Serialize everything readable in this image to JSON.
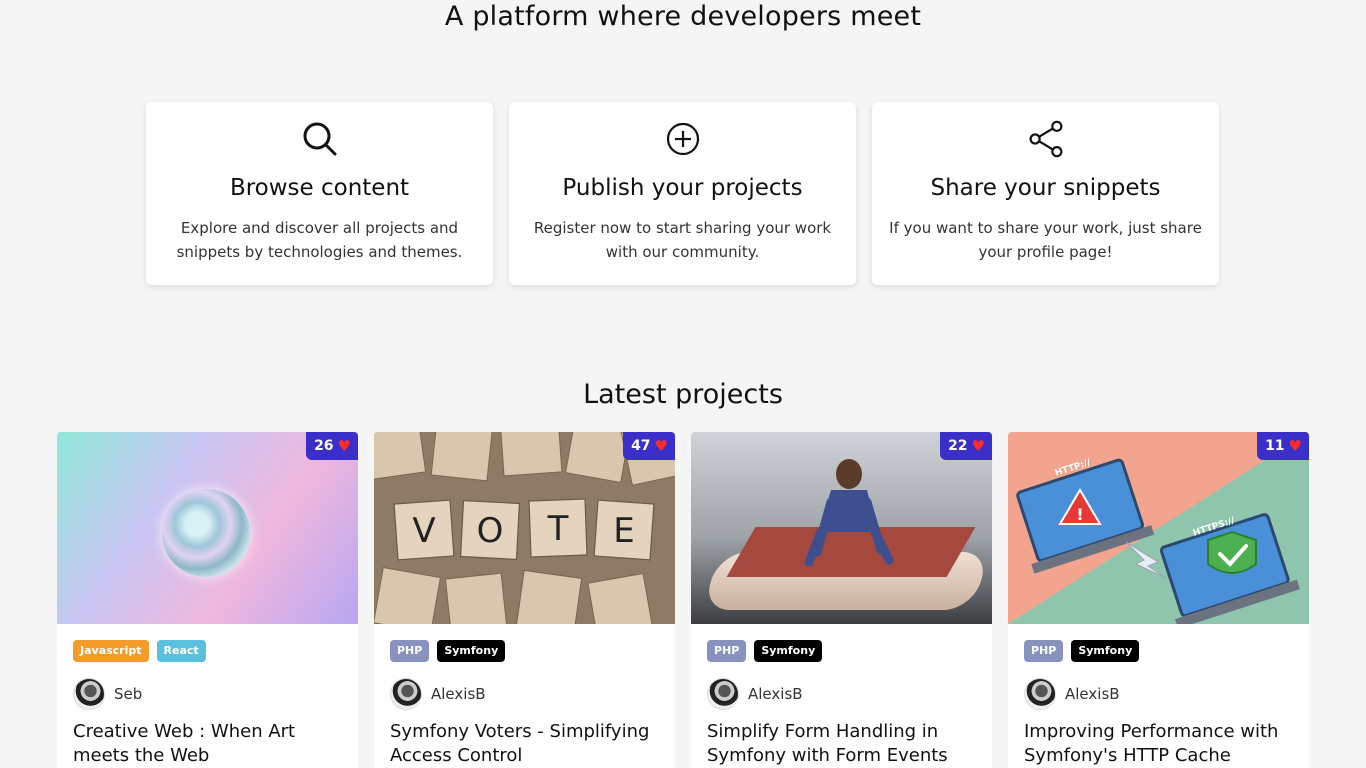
{
  "headline": "A platform where developers meet",
  "features": [
    {
      "icon": "search-icon",
      "title": "Browse content",
      "desc": "Explore and discover all projects and snippets by technologies and themes."
    },
    {
      "icon": "plus-circle-icon",
      "title": "Publish your projects",
      "desc": "Register now to start sharing your work with our community."
    },
    {
      "icon": "share-icon",
      "title": "Share your snippets",
      "desc": "If you want to share your work, just share your profile page!"
    }
  ],
  "latest_title": "Latest projects",
  "colors": {
    "likes_badge": "#3b2fc9",
    "heart": "#ff2b2b",
    "javascript": "#f39c2a",
    "react": "#5bc0de",
    "php": "#8892bf",
    "symfony": "#000000"
  },
  "projects": [
    {
      "likes": "26",
      "tags": [
        {
          "label": "Javascript",
          "color": "#f39c2a"
        },
        {
          "label": "React",
          "color": "#5bc0de"
        }
      ],
      "author": "Seb",
      "title": "Creative Web : When Art meets the Web"
    },
    {
      "likes": "47",
      "tags": [
        {
          "label": "PHP",
          "color": "#8892bf"
        },
        {
          "label": "Symfony",
          "color": "#000000"
        }
      ],
      "author": "AlexisB",
      "title": "Symfony Voters - Simplifying Access Control"
    },
    {
      "likes": "22",
      "tags": [
        {
          "label": "PHP",
          "color": "#8892bf"
        },
        {
          "label": "Symfony",
          "color": "#000000"
        }
      ],
      "author": "AlexisB",
      "title": "Simplify Form Handling in Symfony with Form Events"
    },
    {
      "likes": "11",
      "tags": [
        {
          "label": "PHP",
          "color": "#8892bf"
        },
        {
          "label": "Symfony",
          "color": "#000000"
        }
      ],
      "author": "AlexisB",
      "title": "Improving Performance with Symfony's HTTP Cache"
    }
  ],
  "thumb_lettering": {
    "vote_tiles": [
      "V",
      "O",
      "T",
      "E"
    ],
    "https_labels": [
      "HTTP://",
      "HTTPS://"
    ]
  }
}
